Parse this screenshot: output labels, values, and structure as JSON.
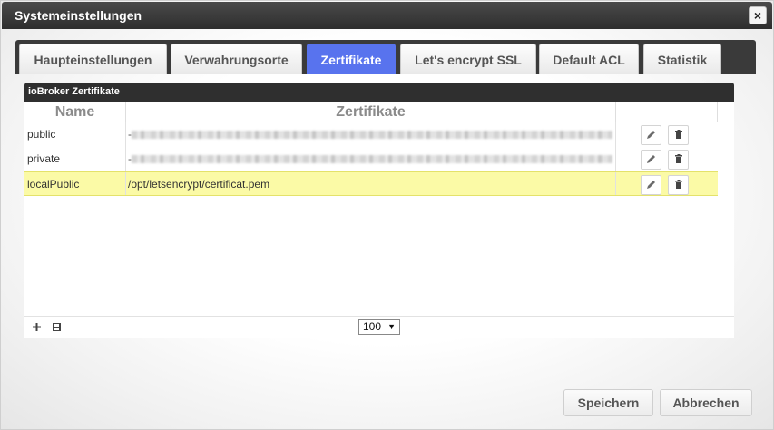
{
  "dialog": {
    "title": "Systemeinstellungen",
    "close_label": "×"
  },
  "tabs": [
    {
      "label": "Haupteinstellungen"
    },
    {
      "label": "Verwahrungsorte"
    },
    {
      "label": "Zertifikate",
      "active": true
    },
    {
      "label": "Let's encrypt SSL"
    },
    {
      "label": "Default ACL"
    },
    {
      "label": "Statistik"
    }
  ],
  "panel": {
    "title": "ioBroker Zertifikate",
    "columns": {
      "name": "Name",
      "cert": "Zertifikate"
    },
    "rows": [
      {
        "name": "public",
        "cert": "-",
        "cert_blurred": true
      },
      {
        "name": "private",
        "cert": "-",
        "cert_blurred": true
      },
      {
        "name": "localPublic",
        "cert": "/opt/letsencrypt/certificat.pem",
        "cert_blurred": false,
        "selected": true
      }
    ]
  },
  "footer": {
    "page_size": "100",
    "page_size_arrow": "▼"
  },
  "actions": {
    "save_label": "Speichern",
    "cancel_label": "Abbrechen"
  },
  "colors": {
    "active_tab": "#5873ee",
    "selected_row": "#fbfaa6",
    "titlebar": "#333333"
  },
  "icons": {
    "close": "close-icon",
    "edit": "pencil-icon",
    "delete": "trash-icon",
    "add": "plus-icon",
    "save": "floppy-icon"
  }
}
